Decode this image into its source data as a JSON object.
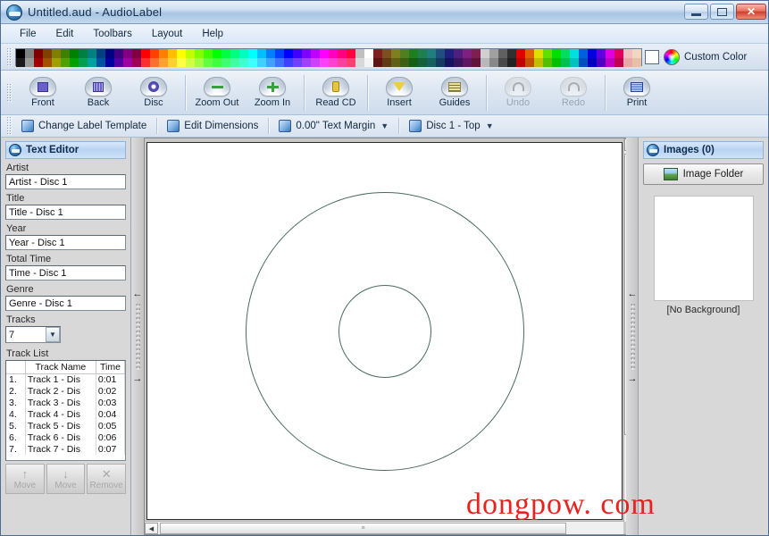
{
  "window": {
    "title": "Untitled.aud - AudioLabel",
    "app_icon": "audiolabel-disc-icon",
    "minimize_label": "Minimize",
    "maximize_label": "Maximize",
    "close_label": "✕"
  },
  "menubar": {
    "items": [
      {
        "label": "File"
      },
      {
        "label": "Edit"
      },
      {
        "label": "Toolbars"
      },
      {
        "label": "Layout"
      },
      {
        "label": "Help"
      }
    ]
  },
  "palette": {
    "custom_color_label": "Custom Color",
    "selected_swatch": "#ffffff",
    "row1": [
      "#000000",
      "#808080",
      "#800000",
      "#804000",
      "#808000",
      "#408000",
      "#008000",
      "#008040",
      "#008080",
      "#004080",
      "#000080",
      "#400080",
      "#800080",
      "#800040",
      "#ff0000",
      "#ff4000",
      "#ff8000",
      "#ffbf00",
      "#ffff00",
      "#bfff00",
      "#80ff00",
      "#40ff00",
      "#00ff00",
      "#00ff40",
      "#00ff80",
      "#00ffbf",
      "#00ffff",
      "#00bfff",
      "#0080ff",
      "#0040ff",
      "#0000ff",
      "#4000ff",
      "#8000ff",
      "#bf00ff",
      "#ff00ff",
      "#ff00bf",
      "#ff0080",
      "#ff0040",
      "#c0c0c0",
      "#ffffff",
      "#7f1f1f",
      "#7f4f1f",
      "#7f7f1f",
      "#4f7f1f",
      "#1f7f1f",
      "#1f7f4f",
      "#1f7f7f",
      "#1f4f7f",
      "#1f1f7f",
      "#4f1f7f",
      "#7f1f7f",
      "#7f1f4f",
      "#d0d0d0",
      "#a0a0a0",
      "#606060",
      "#303030",
      "#e00000",
      "#e06000",
      "#e0e000",
      "#60e000",
      "#00e000",
      "#00e060",
      "#00e0e0",
      "#0060e0",
      "#0000e0",
      "#6000e0",
      "#e000e0",
      "#e00060",
      "#f0c0c0",
      "#f0d8c0"
    ],
    "row2": [
      "#1a1a1a",
      "#9a9a9a",
      "#a00000",
      "#a05000",
      "#a0a000",
      "#50a000",
      "#00a000",
      "#00a050",
      "#00a0a0",
      "#0050a0",
      "#0000a0",
      "#5000a0",
      "#a000a0",
      "#a00050",
      "#ff3030",
      "#ff7030",
      "#ffa030",
      "#ffd030",
      "#ffff40",
      "#d0ff40",
      "#a0ff40",
      "#60ff40",
      "#40ff40",
      "#40ff70",
      "#40ffa0",
      "#40ffd0",
      "#40ffff",
      "#40d0ff",
      "#40a0ff",
      "#4070ff",
      "#4040ff",
      "#7040ff",
      "#a040ff",
      "#d040ff",
      "#ff40ff",
      "#ff40d0",
      "#ff40a0",
      "#ff4070",
      "#d8d8d8",
      "#f4f4f4",
      "#5f1515",
      "#5f3a15",
      "#5f5f15",
      "#3a5f15",
      "#155f15",
      "#155f3a",
      "#155f5f",
      "#153a5f",
      "#15155f",
      "#3a155f",
      "#5f155f",
      "#5f153a",
      "#b8b8b8",
      "#888888",
      "#4a4a4a",
      "#222222",
      "#c00000",
      "#c05000",
      "#c0c000",
      "#50c000",
      "#00c000",
      "#00c050",
      "#00c0c0",
      "#0050c0",
      "#0000c0",
      "#5000c0",
      "#c000c0",
      "#c00050",
      "#e8a8a8",
      "#e8c0a8"
    ]
  },
  "toolbar": {
    "buttons": [
      {
        "label": "Front",
        "icon": "front-cover-icon",
        "enabled": true
      },
      {
        "label": "Back",
        "icon": "back-cover-icon",
        "enabled": true
      },
      {
        "label": "Disc",
        "icon": "disc-icon",
        "enabled": true
      },
      {
        "label": "Zoom Out",
        "icon": "zoom-out-icon",
        "enabled": true
      },
      {
        "label": "Zoom In",
        "icon": "zoom-in-icon",
        "enabled": true
      },
      {
        "label": "Read CD",
        "icon": "read-cd-icon",
        "enabled": true
      },
      {
        "label": "Insert",
        "icon": "insert-icon",
        "enabled": true
      },
      {
        "label": "Guides",
        "icon": "guides-icon",
        "enabled": true
      },
      {
        "label": "Undo",
        "icon": "undo-icon",
        "enabled": false
      },
      {
        "label": "Redo",
        "icon": "redo-icon",
        "enabled": false
      },
      {
        "label": "Print",
        "icon": "print-icon",
        "enabled": true
      }
    ]
  },
  "toolbar2": {
    "change_label_template": "Change Label Template",
    "edit_dimensions": "Edit Dimensions",
    "text_margin": "0.00\" Text Margin",
    "label_side": "Disc 1 - Top",
    "caret": "▼"
  },
  "left_panel": {
    "title": "Text Editor",
    "fields": [
      {
        "label": "Artist",
        "value": "Artist - Disc 1"
      },
      {
        "label": "Title",
        "value": "Title - Disc 1"
      },
      {
        "label": "Year",
        "value": "Year - Disc 1"
      },
      {
        "label": "Total Time",
        "value": "Time - Disc 1"
      },
      {
        "label": "Genre",
        "value": "Genre - Disc 1"
      }
    ],
    "tracks_label": "Tracks",
    "tracks_value": "7",
    "track_list_label": "Track List",
    "track_columns": [
      "",
      "Track Name",
      "Time"
    ],
    "tracks": [
      {
        "num": "1.",
        "name": "Track 1 - Dis",
        "time": "0:01"
      },
      {
        "num": "2.",
        "name": "Track 2 - Dis",
        "time": "0:02"
      },
      {
        "num": "3.",
        "name": "Track 3 - Dis",
        "time": "0:03"
      },
      {
        "num": "4.",
        "name": "Track 4 - Dis",
        "time": "0:04"
      },
      {
        "num": "5.",
        "name": "Track 5 - Dis",
        "time": "0:05"
      },
      {
        "num": "6.",
        "name": "Track 6 - Dis",
        "time": "0:06"
      },
      {
        "num": "7.",
        "name": "Track 7 - Dis",
        "time": "0:07"
      }
    ],
    "track_buttons": [
      {
        "label": "Move",
        "icon": "move-up-icon",
        "glyph": "↑",
        "enabled": false
      },
      {
        "label": "Move",
        "icon": "move-down-icon",
        "glyph": "↓",
        "enabled": false
      },
      {
        "label": "Remove",
        "icon": "remove-icon",
        "glyph": "✕",
        "enabled": false
      }
    ]
  },
  "right_panel": {
    "title": "Images (0)",
    "image_folder_label": "Image Folder",
    "no_background_label": "[No Background]"
  },
  "canvas": {
    "label_type": "cd-disc-outline",
    "scroll_up": "▲",
    "scroll_down": "▼",
    "scroll_left": "◀",
    "scroll_right": "▶",
    "thumb_grip": "≡"
  },
  "splitter": {
    "collapse_left": "←",
    "collapse_right": "→"
  },
  "watermark": {
    "text": "dongpow. com",
    "color": "#e8221f"
  }
}
